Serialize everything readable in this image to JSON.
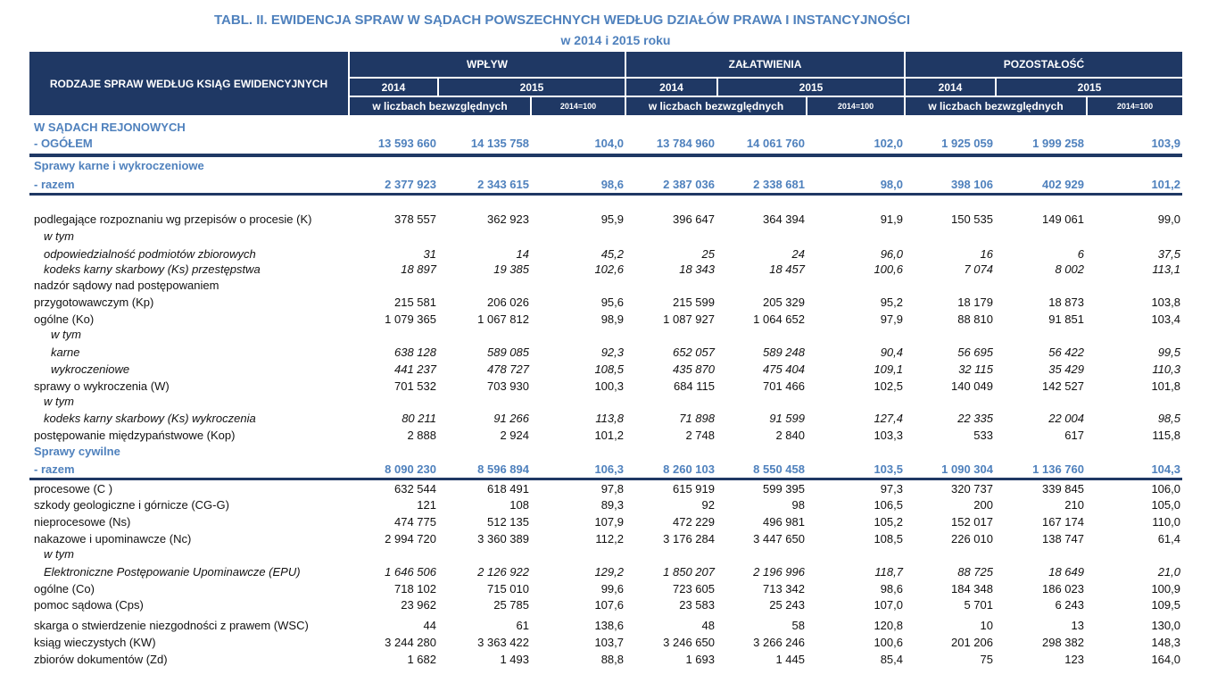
{
  "title": {
    "line1": "TABL. II.    EWIDENCJA SPRAW W SĄDACH POWSZECHNYCH WEDŁUG DZIAŁÓW PRAWA I INSTANCYJNOŚCI",
    "line2": "w  2014  i  2015 roku"
  },
  "header": {
    "rodzaje": "RODZAJE SPRAW WEDŁUG KSIĄG EWIDENCYJNYCH",
    "groups": [
      "WPŁYW",
      "ZAŁATWIENIA",
      "POZOSTAŁOŚĆ"
    ],
    "year2014": "2014",
    "year2015": "2015",
    "absolute": "w liczbach bezwzględnych",
    "index": "2014=100"
  },
  "rows": [
    {
      "label": "W SĄDACH REJONOWYCH",
      "style": "blue",
      "values": [
        "",
        "",
        "",
        "",
        "",
        "",
        "",
        "",
        ""
      ]
    },
    {
      "label": "- OGÓŁEM",
      "style": "blue",
      "values": [
        "13 593 660",
        "14 135 758",
        "104,0",
        "13 784 960",
        "14 061 760",
        "102,0",
        "1 925 059",
        "1 999 258",
        "103,9"
      ]
    },
    {
      "label": "Sprawy karne i wykroczeniowe",
      "style": "blue",
      "values": [
        "",
        "",
        "",
        "",
        "",
        "",
        "",
        "",
        ""
      ]
    },
    {
      "label": "- razem",
      "style": "blue",
      "values": [
        "2 377 923",
        "2 343 615",
        "98,6",
        "2 387 036",
        "2 338 681",
        "98,0",
        "398 106",
        "402 929",
        "101,2"
      ]
    },
    {
      "label": "podlegające rozpoznaniu wg przepisów o procesie (K)",
      "style": "",
      "values": [
        "378 557",
        "362 923",
        "95,9",
        "396 647",
        "364 394",
        "91,9",
        "150 535",
        "149 061",
        "99,0"
      ]
    },
    {
      "label": "w tym",
      "style": "it ind1",
      "values": [
        "",
        "",
        "",
        "",
        "",
        "",
        "",
        "",
        ""
      ]
    },
    {
      "label": "odpowiedzialność podmiotów    zbiorowych",
      "style": "it ind1",
      "values": [
        "31",
        "14",
        "45,2",
        "25",
        "24",
        "96,0",
        "16",
        "6",
        "37,5"
      ]
    },
    {
      "label": "kodeks karny skarbowy (Ks) przestępstwa",
      "style": "it ind1",
      "values": [
        "18 897",
        "19 385",
        "102,6",
        "18 343",
        "18 457",
        "100,6",
        "7 074",
        "8 002",
        "113,1"
      ]
    },
    {
      "label": "nadzór sądowy nad postępowaniem",
      "style": "",
      "values": [
        "",
        "",
        "",
        "",
        "",
        "",
        "",
        "",
        ""
      ]
    },
    {
      "label": "przygotowawczym (Kp)",
      "style": "",
      "values": [
        "215 581",
        "206 026",
        "95,6",
        "215 599",
        "205 329",
        "95,2",
        "18 179",
        "18 873",
        "103,8"
      ]
    },
    {
      "label": "ogólne (Ko)",
      "style": "",
      "values": [
        "1 079 365",
        "1 067 812",
        "98,9",
        "1 087 927",
        "1 064 652",
        "97,9",
        "88 810",
        "91 851",
        "103,4"
      ]
    },
    {
      "label": "w tym",
      "style": "it ind2",
      "values": [
        "",
        "",
        "",
        "",
        "",
        "",
        "",
        "",
        ""
      ]
    },
    {
      "label": "karne",
      "style": "it ind2",
      "values": [
        "638 128",
        "589 085",
        "92,3",
        "652 057",
        "589 248",
        "90,4",
        "56 695",
        "56 422",
        "99,5"
      ]
    },
    {
      "label": "wykroczeniowe",
      "style": "it ind2",
      "values": [
        "441 237",
        "478 727",
        "108,5",
        "435 870",
        "475 404",
        "109,1",
        "32 115",
        "35 429",
        "110,3"
      ]
    },
    {
      "label": "sprawy o wykroczenia (W)",
      "style": "",
      "values": [
        "701 532",
        "703 930",
        "100,3",
        "684 115",
        "701 466",
        "102,5",
        "140 049",
        "142 527",
        "101,8"
      ]
    },
    {
      "label": "w tym",
      "style": "it ind1",
      "values": [
        "",
        "",
        "",
        "",
        "",
        "",
        "",
        "",
        ""
      ]
    },
    {
      "label": "kodeks karny skarbowy (Ks) wykroczenia",
      "style": "it ind1",
      "values": [
        "80 211",
        "91 266",
        "113,8",
        "71 898",
        "91 599",
        "127,4",
        "22 335",
        "22 004",
        "98,5"
      ]
    },
    {
      "label": "postępowanie międzypaństwowe (Kop)",
      "style": "",
      "values": [
        "2 888",
        "2 924",
        "101,2",
        "2 748",
        "2 840",
        "103,3",
        "533",
        "617",
        "115,8"
      ]
    },
    {
      "label": "Sprawy cywilne",
      "style": "blue",
      "values": [
        "",
        "",
        "",
        "",
        "",
        "",
        "",
        "",
        ""
      ]
    },
    {
      "label": "- razem",
      "style": "blue",
      "values": [
        "8 090 230",
        "8 596 894",
        "106,3",
        "8 260 103",
        "8 550 458",
        "103,5",
        "1 090 304",
        "1 136 760",
        "104,3"
      ]
    },
    {
      "label": "procesowe (C )",
      "style": "",
      "values": [
        "632 544",
        "618 491",
        "97,8",
        "615 919",
        "599 395",
        "97,3",
        "320 737",
        "339 845",
        "106,0"
      ]
    },
    {
      "label": "szkody geologiczne i górnicze (CG-G)",
      "style": "",
      "values": [
        "121",
        "108",
        "89,3",
        "92",
        "98",
        "106,5",
        "200",
        "210",
        "105,0"
      ]
    },
    {
      "label": "nieprocesowe (Ns)",
      "style": "",
      "values": [
        "474 775",
        "512 135",
        "107,9",
        "472 229",
        "496 981",
        "105,2",
        "152 017",
        "167 174",
        "110,0"
      ]
    },
    {
      "label": "nakazowe i upominawcze (Nc)",
      "style": "",
      "values": [
        "2 994 720",
        "3 360 389",
        "112,2",
        "3 176 284",
        "3 447 650",
        "108,5",
        "226 010",
        "138 747",
        "61,4"
      ]
    },
    {
      "label": "w tym",
      "style": "it ind1",
      "values": [
        "",
        "",
        "",
        "",
        "",
        "",
        "",
        "",
        ""
      ]
    },
    {
      "label": "Elektroniczne Postępowanie Upominawcze (EPU)",
      "style": "it ind1",
      "values": [
        "1 646 506",
        "2 126 922",
        "129,2",
        "1 850 207",
        "2 196 996",
        "118,7",
        "88 725",
        "18 649",
        "21,0"
      ]
    },
    {
      "label": "ogólne (Co)",
      "style": "",
      "values": [
        "718 102",
        "715 010",
        "99,6",
        "723 605",
        "713 342",
        "98,6",
        "184 348",
        "186 023",
        "100,9"
      ]
    },
    {
      "label": "pomoc sądowa (Cps)",
      "style": "",
      "values": [
        "23 962",
        "25 785",
        "107,6",
        "23 583",
        "25 243",
        "107,0",
        "5 701",
        "6 243",
        "109,5"
      ]
    },
    {
      "label": "skarga o stwierdzenie niezgodności z prawem (WSC)",
      "style": "",
      "values": [
        "44",
        "61",
        "138,6",
        "48",
        "58",
        "120,8",
        "10",
        "13",
        "130,0"
      ]
    },
    {
      "label": "ksiąg wieczystych (KW)",
      "style": "",
      "values": [
        "3 244 280",
        "3 363 422",
        "103,7",
        "3 246 650",
        "3 266 246",
        "100,6",
        "201 206",
        "298 382",
        "148,3"
      ]
    },
    {
      "label": "zbiorów dokumentów (Zd)",
      "style": "",
      "values": [
        "1 682",
        "1 493",
        "88,8",
        "1 693",
        "1 445",
        "85,4",
        "75",
        "123",
        "164,0"
      ]
    }
  ]
}
